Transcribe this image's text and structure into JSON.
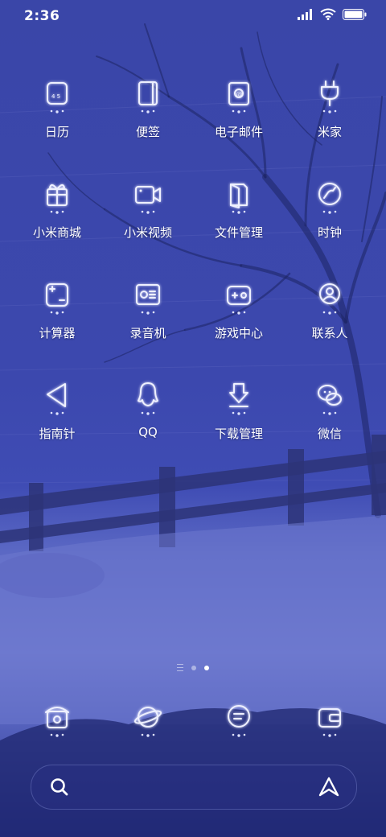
{
  "status": {
    "time": "2:36"
  },
  "apps": [
    {
      "label": "日历",
      "icon": "calendar-icon"
    },
    {
      "label": "便签",
      "icon": "notes-icon"
    },
    {
      "label": "电子邮件",
      "icon": "email-icon"
    },
    {
      "label": "米家",
      "icon": "plug-icon"
    },
    {
      "label": "小米商城",
      "icon": "gift-icon"
    },
    {
      "label": "小米视频",
      "icon": "video-icon"
    },
    {
      "label": "文件管理",
      "icon": "folder-icon"
    },
    {
      "label": "时钟",
      "icon": "clock-icon"
    },
    {
      "label": "计算器",
      "icon": "calculator-icon"
    },
    {
      "label": "录音机",
      "icon": "recorder-icon"
    },
    {
      "label": "游戏中心",
      "icon": "gamepad-icon"
    },
    {
      "label": "联系人",
      "icon": "contacts-icon"
    },
    {
      "label": "指南针",
      "icon": "compass-icon"
    },
    {
      "label": "QQ",
      "icon": "qq-icon"
    },
    {
      "label": "下载管理",
      "icon": "download-icon"
    },
    {
      "label": "微信",
      "icon": "wechat-icon"
    }
  ],
  "dock": [
    {
      "icon": "phone-icon"
    },
    {
      "icon": "browser-icon"
    },
    {
      "icon": "messages-icon"
    },
    {
      "icon": "wallet-icon"
    }
  ],
  "pages": {
    "count": 3,
    "active_index": 2
  }
}
